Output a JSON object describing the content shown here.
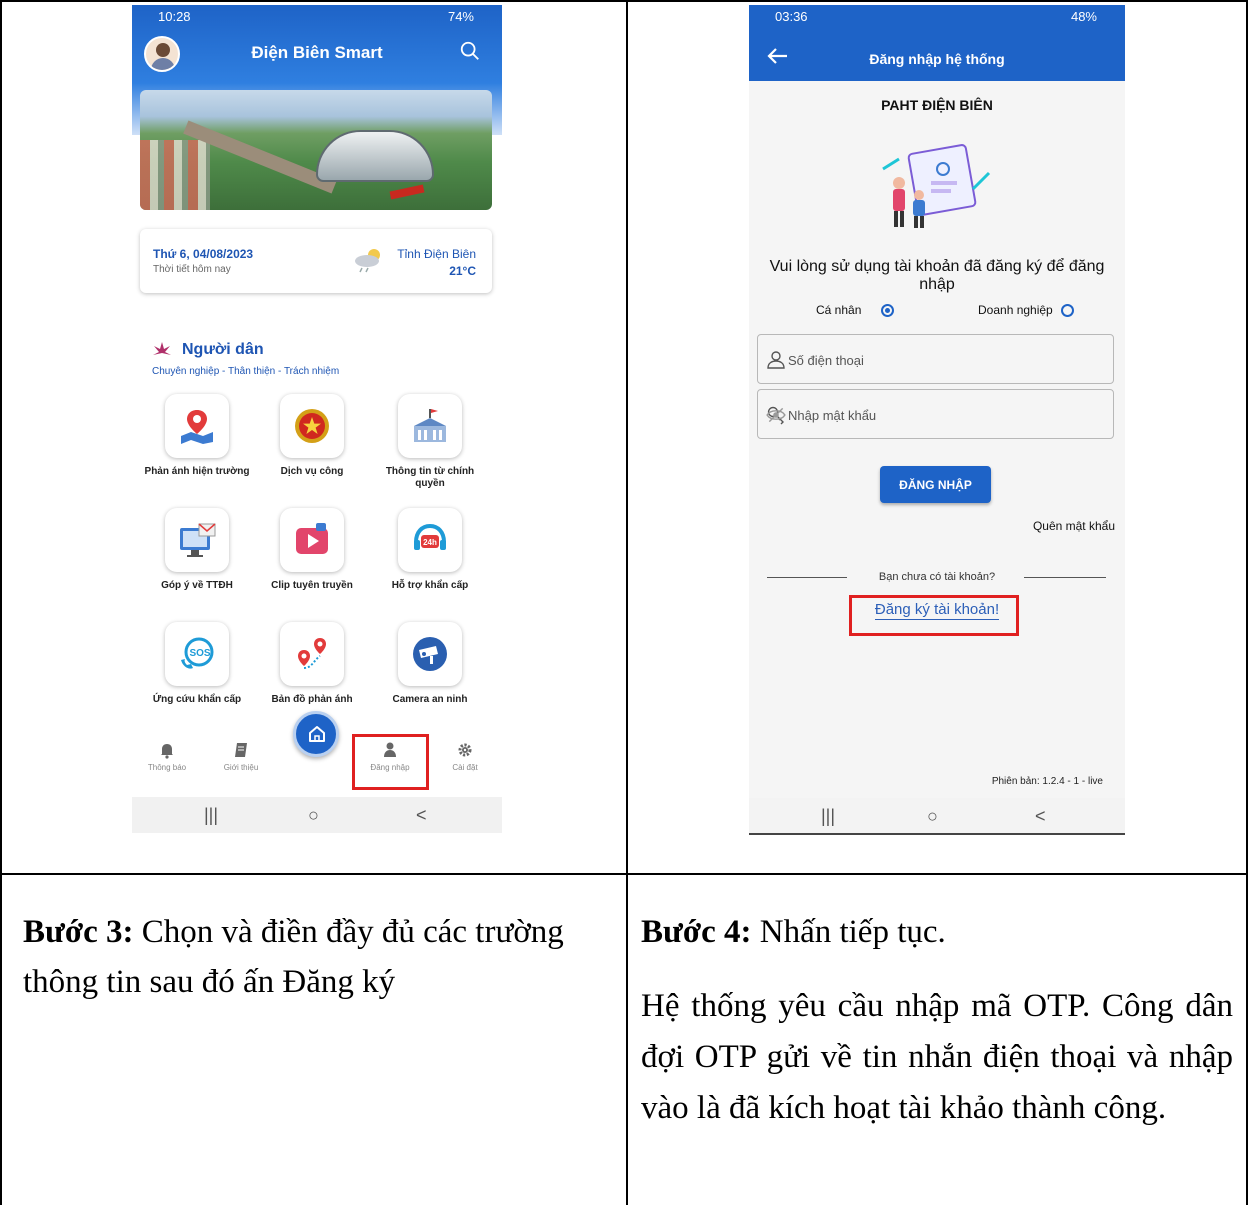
{
  "phone1": {
    "status_time": "10:28",
    "status_right": "74%",
    "app_title": "Điện Biên Smart",
    "weather": {
      "date": "Thứ 6, 04/08/2023",
      "subtitle": "Thời tiết hôm nay",
      "location": "Tỉnh Điện Biên",
      "temperature": "21°C"
    },
    "section_title": "Người dân",
    "section_subtitle": "Chuyên nghiệp - Thân thiện - Trách nhiệm",
    "tiles": [
      {
        "label": "Phản ánh hiện trường",
        "icon": "location-map-icon"
      },
      {
        "label": "Dịch vụ công",
        "icon": "national-emblem-icon"
      },
      {
        "label": "Thông tin từ chính quyền",
        "icon": "government-building-icon"
      },
      {
        "label": "Góp ý về TTĐH",
        "icon": "computer-mail-icon"
      },
      {
        "label": "Clip tuyên truyền",
        "icon": "video-play-icon"
      },
      {
        "label": "Hỗ trợ khẩn cấp",
        "icon": "support-24h-icon"
      },
      {
        "label": "Ứng cứu khẩn cấp",
        "icon": "sos-phone-icon"
      },
      {
        "label": "Bản đồ phản ánh",
        "icon": "map-pins-icon"
      },
      {
        "label": "Camera an ninh",
        "icon": "security-camera-icon"
      }
    ],
    "tabbar": {
      "notify": "Thông báo",
      "intro": "Giới thiệu",
      "login": "Đăng nhập",
      "settings": "Cài đặt"
    },
    "nav": {
      "recent": "|||",
      "home": "○",
      "back": "<"
    }
  },
  "phone2": {
    "status_time": "03:36",
    "status_right": "48%",
    "header_title": "Đăng nhập hệ thống",
    "brand": "PAHT ĐIỆN BIÊN",
    "message": "Vui lòng sử dụng tài khoản đã đăng ký để đăng nhập",
    "radio_personal": "Cá nhân",
    "radio_business": "Doanh nghiệp",
    "phone_placeholder": "Số điện thoại",
    "password_placeholder": "Nhập mật khẩu",
    "login_button": "ĐĂNG NHẬP",
    "forgot": "Quên mật khẩu",
    "no_account": "Bạn chưa có tài khoản?",
    "register": "Đăng ký tài khoản!",
    "version": "Phiên bản: 1.2.4 - 1 - live",
    "nav": {
      "recent": "|||",
      "home": "○",
      "back": "<"
    }
  },
  "step3": {
    "label": "Bước 3:",
    "text": " Chọn và điền đầy đủ các trường thông tin sau đó ấn Đăng ký"
  },
  "step4": {
    "label": "Bước 4:",
    "text": " Nhấn tiếp tục.",
    "detail": "Hệ thống yêu cầu nhập mã OTP. Công dân đợi OTP gửi về tin nhắn điện thoại và nhập vào là đã kích hoạt tài khảo thành công."
  },
  "colors": {
    "accent": "#1e63c7",
    "highlight": "#e02020"
  }
}
